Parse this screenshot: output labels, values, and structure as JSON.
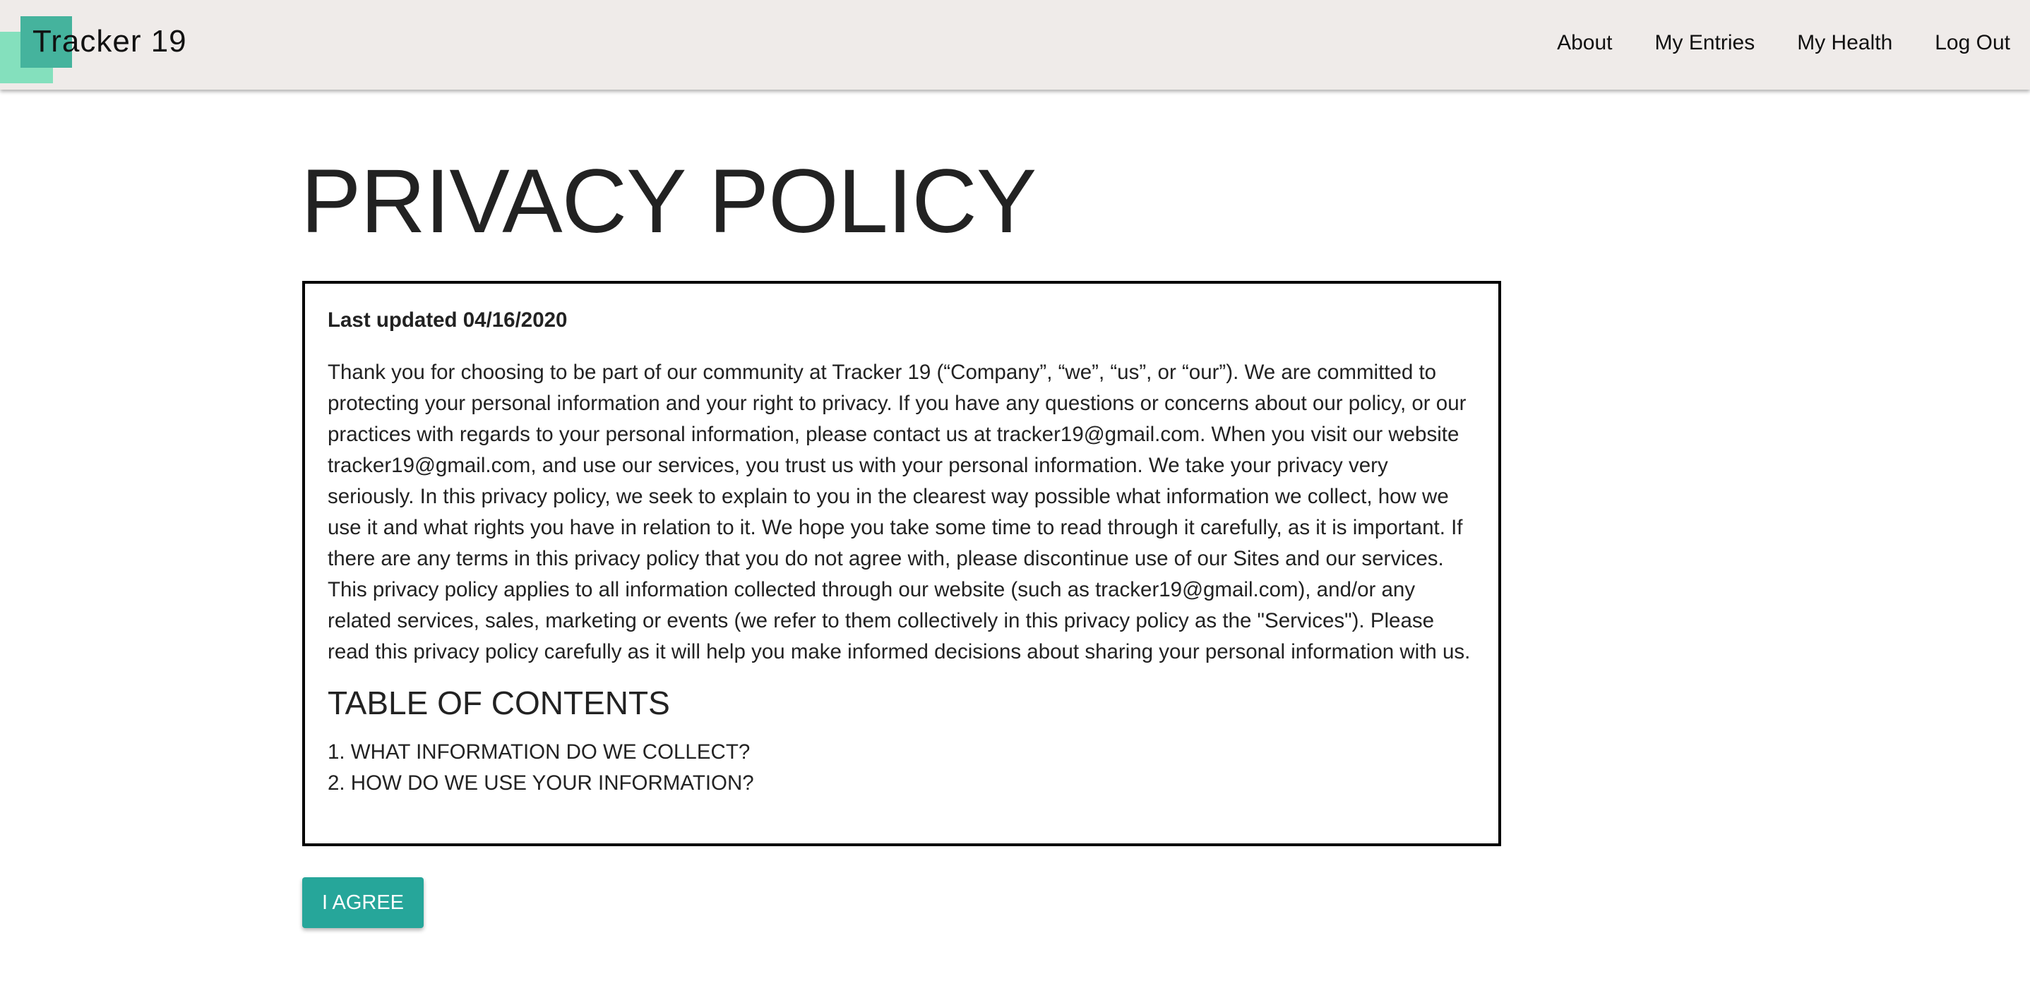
{
  "navbar": {
    "brand": "Tracker 19",
    "links": [
      "About",
      "My Entries",
      "My Health",
      "Log Out"
    ],
    "brand_colors": {
      "back_square": "#84e0bd",
      "front_square": "#45b39d"
    }
  },
  "page": {
    "title": "PRIVACY POLICY",
    "last_updated": "Last updated 04/16/2020",
    "intro": "Thank you for choosing to be part of our community at Tracker 19 (“Company”, “we”, “us”, or “our”). We are committed to protecting your personal information and your right to privacy. If you have any questions or concerns about our policy, or our practices with regards to your personal information, please contact us at tracker19@gmail.com. When you visit our website tracker19@gmail.com, and use our services, you trust us with your personal information. We take your privacy very seriously. In this privacy policy, we seek to explain to you in the clearest way possible what information we collect, how we use it and what rights you have in relation to it. We hope you take some time to read through it carefully, as it is important. If there are any terms in this privacy policy that you do not agree with, please discontinue use of our Sites and our services. This privacy policy applies to all information collected through our website (such as tracker19@gmail.com), and/or any related services, sales, marketing or events (we refer to them collectively in this privacy policy as the \"Services\"). Please read this privacy policy carefully as it will help you make informed decisions about sharing your personal information with us.",
    "toc_heading": "TABLE OF CONTENTS",
    "toc": [
      "1. WHAT INFORMATION DO WE COLLECT?",
      "2. HOW DO WE USE YOUR INFORMATION?"
    ],
    "agree_button": "I AGREE",
    "accent_color": "#26a69a"
  }
}
